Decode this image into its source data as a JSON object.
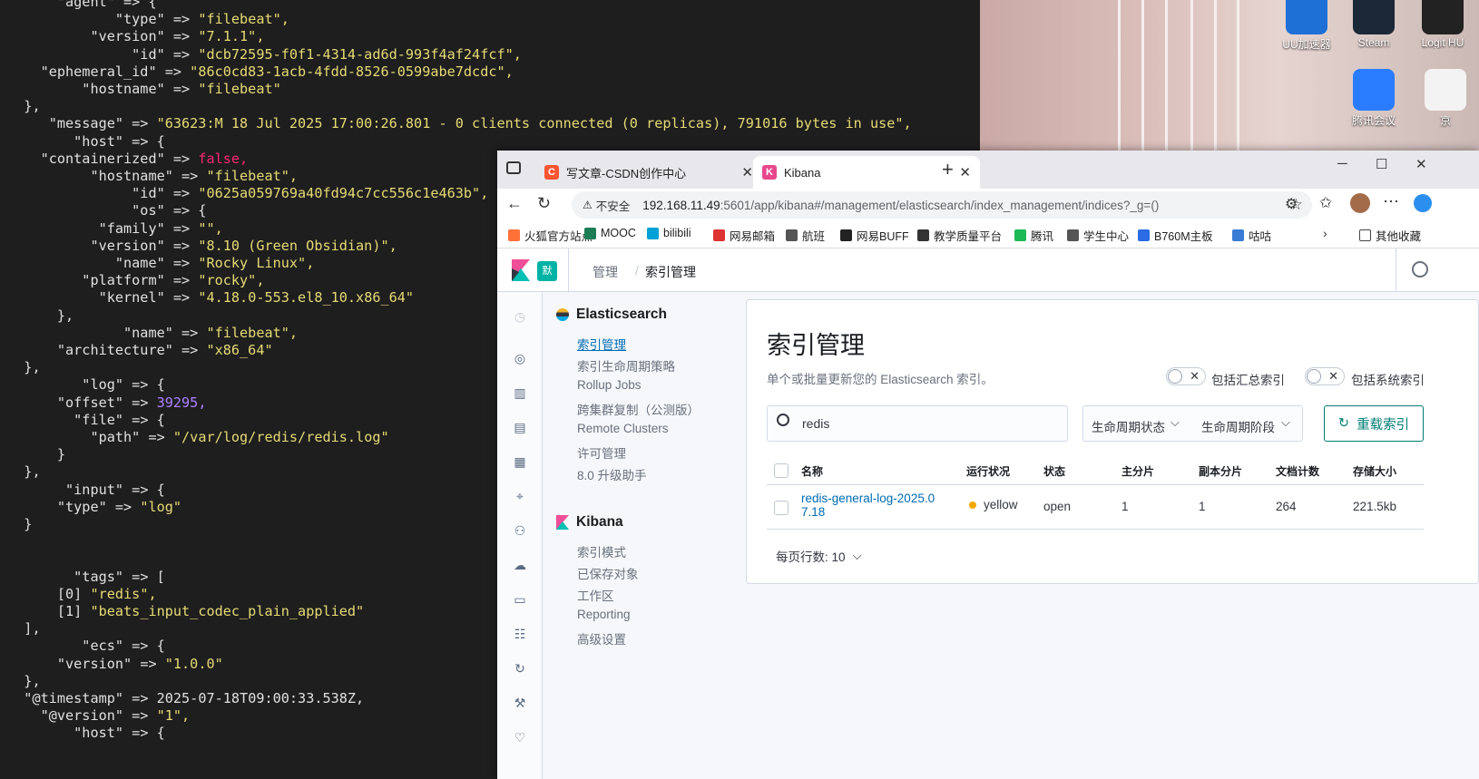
{
  "terminal": {
    "lines": [
      {
        "indent": "      ",
        "key": "\"agent\"",
        "op": " => {",
        "val": "",
        "vcls": "s"
      },
      {
        "indent": "             ",
        "key": "\"type\"",
        "op": " => ",
        "val": "\"filebeat\",",
        "vcls": "s"
      },
      {
        "indent": "          ",
        "key": "\"version\"",
        "op": " => ",
        "val": "\"7.1.1\",",
        "vcls": "s"
      },
      {
        "indent": "               ",
        "key": "\"id\"",
        "op": " => ",
        "val": "\"dcb72595-f0f1-4314-ad6d-993f4af24fcf\",",
        "vcls": "s"
      },
      {
        "indent": "    ",
        "key": "\"ephemeral_id\"",
        "op": " => ",
        "val": "\"86c0cd83-1acb-4fdd-8526-0599abe7dcdc\",",
        "vcls": "s"
      },
      {
        "indent": "         ",
        "key": "\"hostname\"",
        "op": " => ",
        "val": "\"filebeat\"",
        "vcls": "s"
      },
      {
        "indent": "  ",
        "key": "},",
        "op": "",
        "val": "",
        "vcls": "s"
      },
      {
        "indent": "     ",
        "key": "\"message\"",
        "op": " => ",
        "val": "\"63623:M 18 Jul 2025 17:00:26.801 - 0 clients connected (0 replicas), 791016 bytes in use\",",
        "vcls": "s"
      },
      {
        "indent": "        ",
        "key": "\"host\"",
        "op": " => {",
        "val": "",
        "vcls": "s"
      },
      {
        "indent": "    ",
        "key": "\"containerized\"",
        "op": " => ",
        "val": "false,",
        "vcls": "b"
      },
      {
        "indent": "          ",
        "key": "\"hostname\"",
        "op": " => ",
        "val": "\"filebeat\",",
        "vcls": "s"
      },
      {
        "indent": "               ",
        "key": "\"id\"",
        "op": " => ",
        "val": "\"0625a059769a40fd94c7cc556c1e463b\",",
        "vcls": "s"
      },
      {
        "indent": "               ",
        "key": "\"os\"",
        "op": " => {",
        "val": "",
        "vcls": "s"
      },
      {
        "indent": "           ",
        "key": "\"family\"",
        "op": " => ",
        "val": "\"\",",
        "vcls": "s"
      },
      {
        "indent": "          ",
        "key": "\"version\"",
        "op": " => ",
        "val": "\"8.10 (Green Obsidian)\",",
        "vcls": "s"
      },
      {
        "indent": "             ",
        "key": "\"name\"",
        "op": " => ",
        "val": "\"Rocky Linux\",",
        "vcls": "s"
      },
      {
        "indent": "         ",
        "key": "\"platform\"",
        "op": " => ",
        "val": "\"rocky\",",
        "vcls": "s"
      },
      {
        "indent": "           ",
        "key": "\"kernel\"",
        "op": " => ",
        "val": "\"4.18.0-553.el8_10.x86_64\"",
        "vcls": "s"
      },
      {
        "indent": "      ",
        "key": "},",
        "op": "",
        "val": "",
        "vcls": "s"
      },
      {
        "indent": "              ",
        "key": "\"name\"",
        "op": " => ",
        "val": "\"filebeat\",",
        "vcls": "s"
      },
      {
        "indent": "      ",
        "key": "\"architecture\"",
        "op": " => ",
        "val": "\"x86_64\"",
        "vcls": "s"
      },
      {
        "indent": "  ",
        "key": "},",
        "op": "",
        "val": "",
        "vcls": "s"
      },
      {
        "indent": "         ",
        "key": "\"log\"",
        "op": " => {",
        "val": "",
        "vcls": "s"
      },
      {
        "indent": "      ",
        "key": "\"offset\"",
        "op": " => ",
        "val": "39295,",
        "vcls": "n"
      },
      {
        "indent": "        ",
        "key": "\"file\"",
        "op": " => {",
        "val": "",
        "vcls": "s"
      },
      {
        "indent": "          ",
        "key": "\"path\"",
        "op": " => ",
        "val": "\"/var/log/redis/redis.log\"",
        "vcls": "s"
      },
      {
        "indent": "      ",
        "key": "}",
        "op": "",
        "val": "",
        "vcls": "s"
      },
      {
        "indent": "  ",
        "key": "},",
        "op": "",
        "val": "",
        "vcls": "s"
      },
      {
        "indent": "       ",
        "key": "\"input\"",
        "op": " => {",
        "val": "",
        "vcls": "s"
      },
      {
        "indent": "      ",
        "key": "\"type\"",
        "op": " => ",
        "val": "\"log\"",
        "vcls": "s"
      },
      {
        "indent": "  ",
        "key": "}",
        "op": "",
        "val": "",
        "vcls": "s"
      },
      {
        "indent": "",
        "key": "",
        "op": "",
        "val": "",
        "vcls": "s"
      },
      {
        "indent": "",
        "key": "",
        "op": "",
        "val": "",
        "vcls": "s"
      },
      {
        "indent": "        ",
        "key": "\"tags\"",
        "op": " => [",
        "val": "",
        "vcls": "s"
      },
      {
        "indent": "      ",
        "key": "[0] ",
        "op": "",
        "val": "\"redis\",",
        "vcls": "s"
      },
      {
        "indent": "      ",
        "key": "[1] ",
        "op": "",
        "val": "\"beats_input_codec_plain_applied\"",
        "vcls": "s"
      },
      {
        "indent": "  ",
        "key": "],",
        "op": "",
        "val": "",
        "vcls": "s"
      },
      {
        "indent": "         ",
        "key": "\"ecs\"",
        "op": " => {",
        "val": "",
        "vcls": "s"
      },
      {
        "indent": "      ",
        "key": "\"version\"",
        "op": " => ",
        "val": "\"1.0.0\"",
        "vcls": "s"
      },
      {
        "indent": "  ",
        "key": "},",
        "op": "",
        "val": "",
        "vcls": "s"
      },
      {
        "indent": "  ",
        "key": "\"@timestamp\"",
        "op": " => ",
        "val": "2025-07-18T09:00:33.538Z,",
        "vcls": "k"
      },
      {
        "indent": "    ",
        "key": "\"@version\"",
        "op": " => ",
        "val": "\"1\",",
        "vcls": "s"
      },
      {
        "indent": "        ",
        "key": "\"host\"",
        "op": " => {",
        "val": "",
        "vcls": "s"
      }
    ]
  },
  "desktop": {
    "icons": [
      {
        "label": "UU加速器",
        "color": "#1e6fd6"
      },
      {
        "label": "Steam",
        "color": "#1b2838"
      },
      {
        "label": "Logit HU",
        "color": "#222"
      },
      {
        "label": "腾讯会议",
        "color": "#2a7cff"
      },
      {
        "label": "京",
        "color": "#f3f3f3"
      }
    ]
  },
  "browser": {
    "tabs": [
      {
        "title": "写文章-CSDN创作中心",
        "icon": "C",
        "icon_color": "#fc5531"
      },
      {
        "title": "Kibana",
        "icon": "K",
        "icon_color": "#e8478b"
      }
    ],
    "security": "不安全",
    "url_host": "192.168.11.49",
    "url_rest": ":5601/app/kibana#/management/elasticsearch/index_management/indices?_g=()",
    "bookmarks": [
      {
        "label": "火狐官方站点",
        "color": "#ff7139"
      },
      {
        "label": "MOOC",
        "color": "#1c7c54"
      },
      {
        "label": "bilibili",
        "color": "#00a1d6"
      },
      {
        "label": "网易邮箱",
        "color": "#d33"
      },
      {
        "label": "航班",
        "color": "#555"
      },
      {
        "label": "网易BUFF",
        "color": "#222"
      },
      {
        "label": "教学质量平台",
        "color": "#333"
      },
      {
        "label": "腾讯",
        "color": "#1db954"
      },
      {
        "label": "学生中心",
        "color": "#555"
      },
      {
        "label": "B760M主板",
        "color": "#2b6be3"
      },
      {
        "label": "咕咕",
        "color": "#3a7bd5"
      }
    ],
    "other_bookmarks": "其他收藏"
  },
  "kibana": {
    "space_badge": "默",
    "breadcrumbs": [
      "管理",
      "索引管理"
    ],
    "sections": [
      {
        "title": "Elasticsearch",
        "items": [
          "索引管理",
          "索引生命周期策略",
          "Rollup Jobs",
          "跨集群复制（公测版）",
          "Remote Clusters",
          "许可管理",
          "8.0 升级助手"
        ]
      },
      {
        "title": "Kibana",
        "items": [
          "索引模式",
          "已保存对象",
          "工作区",
          "Reporting",
          "高级设置"
        ]
      }
    ],
    "page": {
      "title": "索引管理",
      "subtitle": "单个或批量更新您的 Elasticsearch 索引。",
      "toggle_rollup": "包括汇总索引",
      "toggle_system": "包括系统索引",
      "search_value": "redis",
      "filter_lifecycle_status": "生命周期状态",
      "filter_lifecycle_phase": "生命周期阶段",
      "reload_button": "重载索引",
      "columns": [
        "名称",
        "运行状况",
        "状态",
        "主分片",
        "副本分片",
        "文档计数",
        "存储大小"
      ],
      "rows": [
        {
          "name_line1": "redis-general-log-2025.0",
          "name_line2": "7.18",
          "health": "yellow",
          "health_color": "#f5a700",
          "status": "open",
          "primary": "1",
          "replica": "1",
          "docs": "264",
          "size": "221.5kb"
        }
      ],
      "rows_per_page": "每页行数: 10"
    }
  }
}
